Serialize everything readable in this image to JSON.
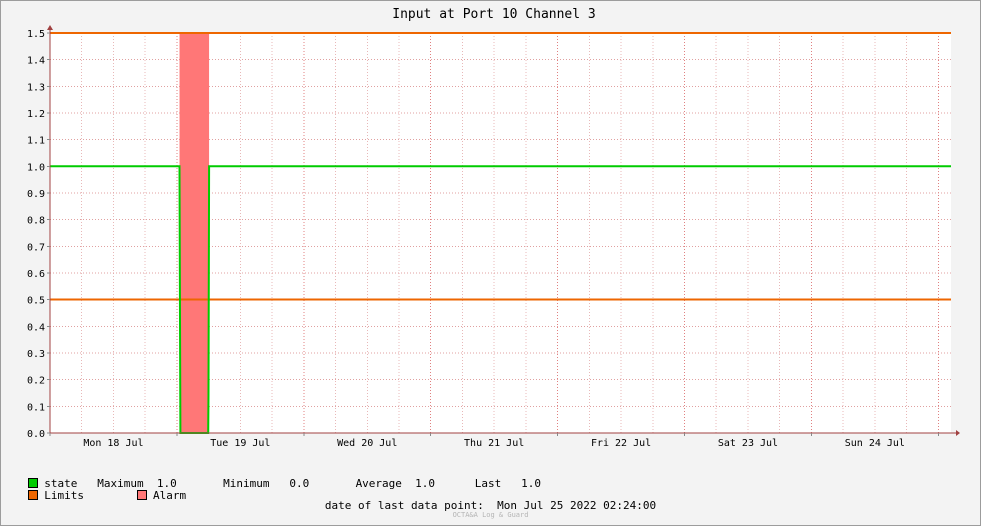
{
  "chart_data": {
    "type": "line",
    "title": "Input at Port 10 Channel 3",
    "x_tick_labels": [
      "Mon 18 Jul",
      "Tue 19 Jul",
      "Wed 20 Jul",
      "Thu 21 Jul",
      "Fri 22 Jul",
      "Sat 23 Jul",
      "Sun 24 Jul"
    ],
    "x_start": "Mon 18 Jul 2022 00:00",
    "x_end": "Mon 25 Jul 2022 02:24",
    "ylim": [
      0,
      1.5
    ],
    "y_tick_labels": [
      "0.0",
      "0.1",
      "0.2",
      "0.3",
      "0.4",
      "0.5",
      "0.6",
      "0.7",
      "0.8",
      "0.9",
      "1.0",
      "1.1",
      "1.2",
      "1.3",
      "1.4",
      "1.5"
    ],
    "grid": true,
    "series": [
      {
        "name": "state",
        "color": "#00cc00",
        "points": [
          [
            "Sun 17 Jul 2022 23:00",
            1.0
          ],
          [
            "Tue 19 Jul 2022 00:30",
            1.0
          ],
          [
            "Tue 19 Jul 2022 00:35",
            0.42
          ],
          [
            "Tue 19 Jul 2022 00:40",
            0.0
          ],
          [
            "Tue 19 Jul 2022 05:55",
            0.0
          ],
          [
            "Tue 19 Jul 2022 05:58",
            0.14
          ],
          [
            "Tue 19 Jul 2022 06:05",
            1.0
          ],
          [
            "Mon 25 Jul 2022 02:24",
            1.0
          ]
        ]
      },
      {
        "name": "Limits",
        "color": "#ee6600",
        "lines": [
          1.5,
          0.5
        ]
      },
      {
        "name": "Alarm",
        "color": "#ff7777",
        "ranges": [
          [
            "Tue 19 Jul 2022 00:30",
            "Tue 19 Jul 2022 06:05"
          ]
        ]
      }
    ]
  },
  "legend": {
    "state": {
      "name": "state",
      "color": "#00cc00",
      "max_label": "Maximum",
      "max_value": "1.0",
      "min_label": "Minimum",
      "min_value": "0.0",
      "avg_label": "Average",
      "avg_value": "1.0",
      "last_label": "Last",
      "last_value": "1.0"
    },
    "limits": {
      "name": "Limits",
      "color": "#ee6600"
    },
    "alarm": {
      "name": "Alarm",
      "color": "#ff7777"
    }
  },
  "footer": {
    "label": "date of last data point:",
    "value": "Mon Jul 25 2022 02:24:00"
  },
  "watermark": "OCTA&A Log & Guard"
}
